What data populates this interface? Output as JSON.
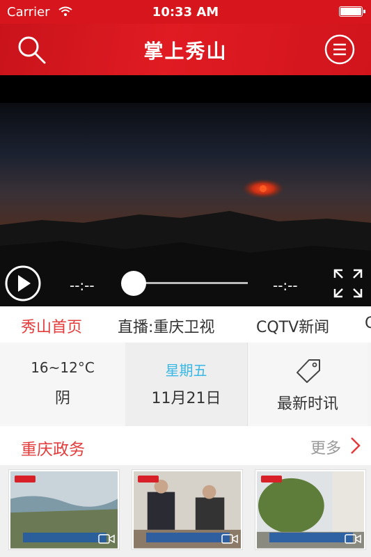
{
  "status_bar": {
    "carrier": "Carrier",
    "time": "10:33 AM"
  },
  "nav": {
    "title": "掌上秀山",
    "accent_color": "#d7151c"
  },
  "player": {
    "elapsed": "--:--",
    "remaining": "--:--",
    "progress": 0
  },
  "tabs": [
    {
      "label": "秀山首页",
      "active": true
    },
    {
      "label": "直播:重庆卫视",
      "active": false
    },
    {
      "label": "CQTV新闻",
      "active": false
    },
    {
      "label": "C",
      "active": false
    }
  ],
  "info": {
    "weather": {
      "temp": "16~12°C",
      "condition": "阴"
    },
    "date": {
      "weekday": "星期五",
      "date": "11月21日"
    },
    "news": {
      "label": "最新时讯"
    }
  },
  "section": {
    "title": "重庆政务",
    "more": "更多"
  },
  "thumbnails": [
    {
      "icon": "video-camera-icon"
    },
    {
      "icon": "video-camera-icon"
    },
    {
      "icon": "video-camera-icon"
    }
  ]
}
